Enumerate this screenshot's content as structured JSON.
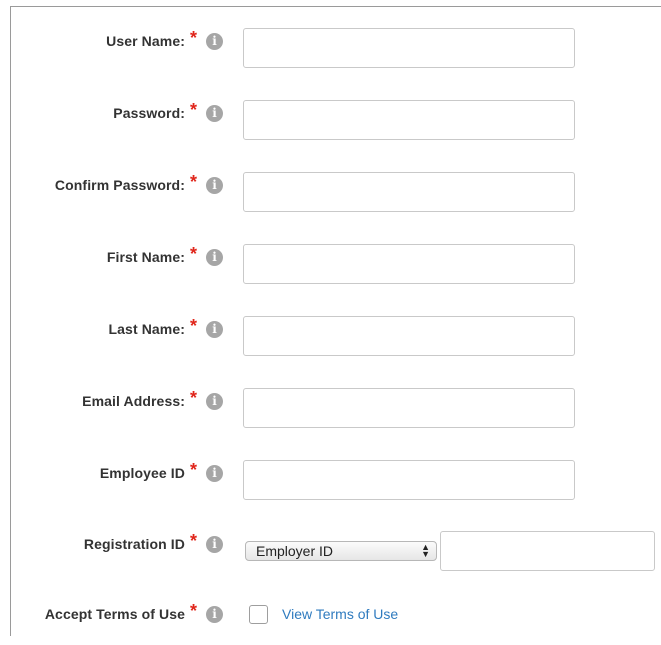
{
  "form": {
    "fields": [
      {
        "label": "User Name:",
        "required_mark": "*",
        "info_icon": "i",
        "value": ""
      },
      {
        "label": "Password:",
        "required_mark": "*",
        "info_icon": "i",
        "value": ""
      },
      {
        "label": "Confirm Password:",
        "required_mark": "*",
        "info_icon": "i",
        "value": ""
      },
      {
        "label": "First Name:",
        "required_mark": "*",
        "info_icon": "i",
        "value": ""
      },
      {
        "label": "Last Name:",
        "required_mark": "*",
        "info_icon": "i",
        "value": ""
      },
      {
        "label": "Email Address:",
        "required_mark": "*",
        "info_icon": "i",
        "value": ""
      },
      {
        "label": "Employee ID",
        "required_mark": "*",
        "info_icon": "i",
        "value": ""
      }
    ],
    "registration": {
      "label": "Registration ID",
      "required_mark": "*",
      "info_icon": "i",
      "select_value": "Employer ID",
      "select_arrows": "⬍",
      "value": ""
    },
    "terms": {
      "label": "Accept Terms of Use",
      "required_mark": "*",
      "info_icon": "i",
      "checked": false,
      "link_text": "View Terms of Use"
    }
  },
  "colors": {
    "required": "#e0261b",
    "link": "#2f7bbf",
    "info_icon": "#a6a6a6"
  }
}
